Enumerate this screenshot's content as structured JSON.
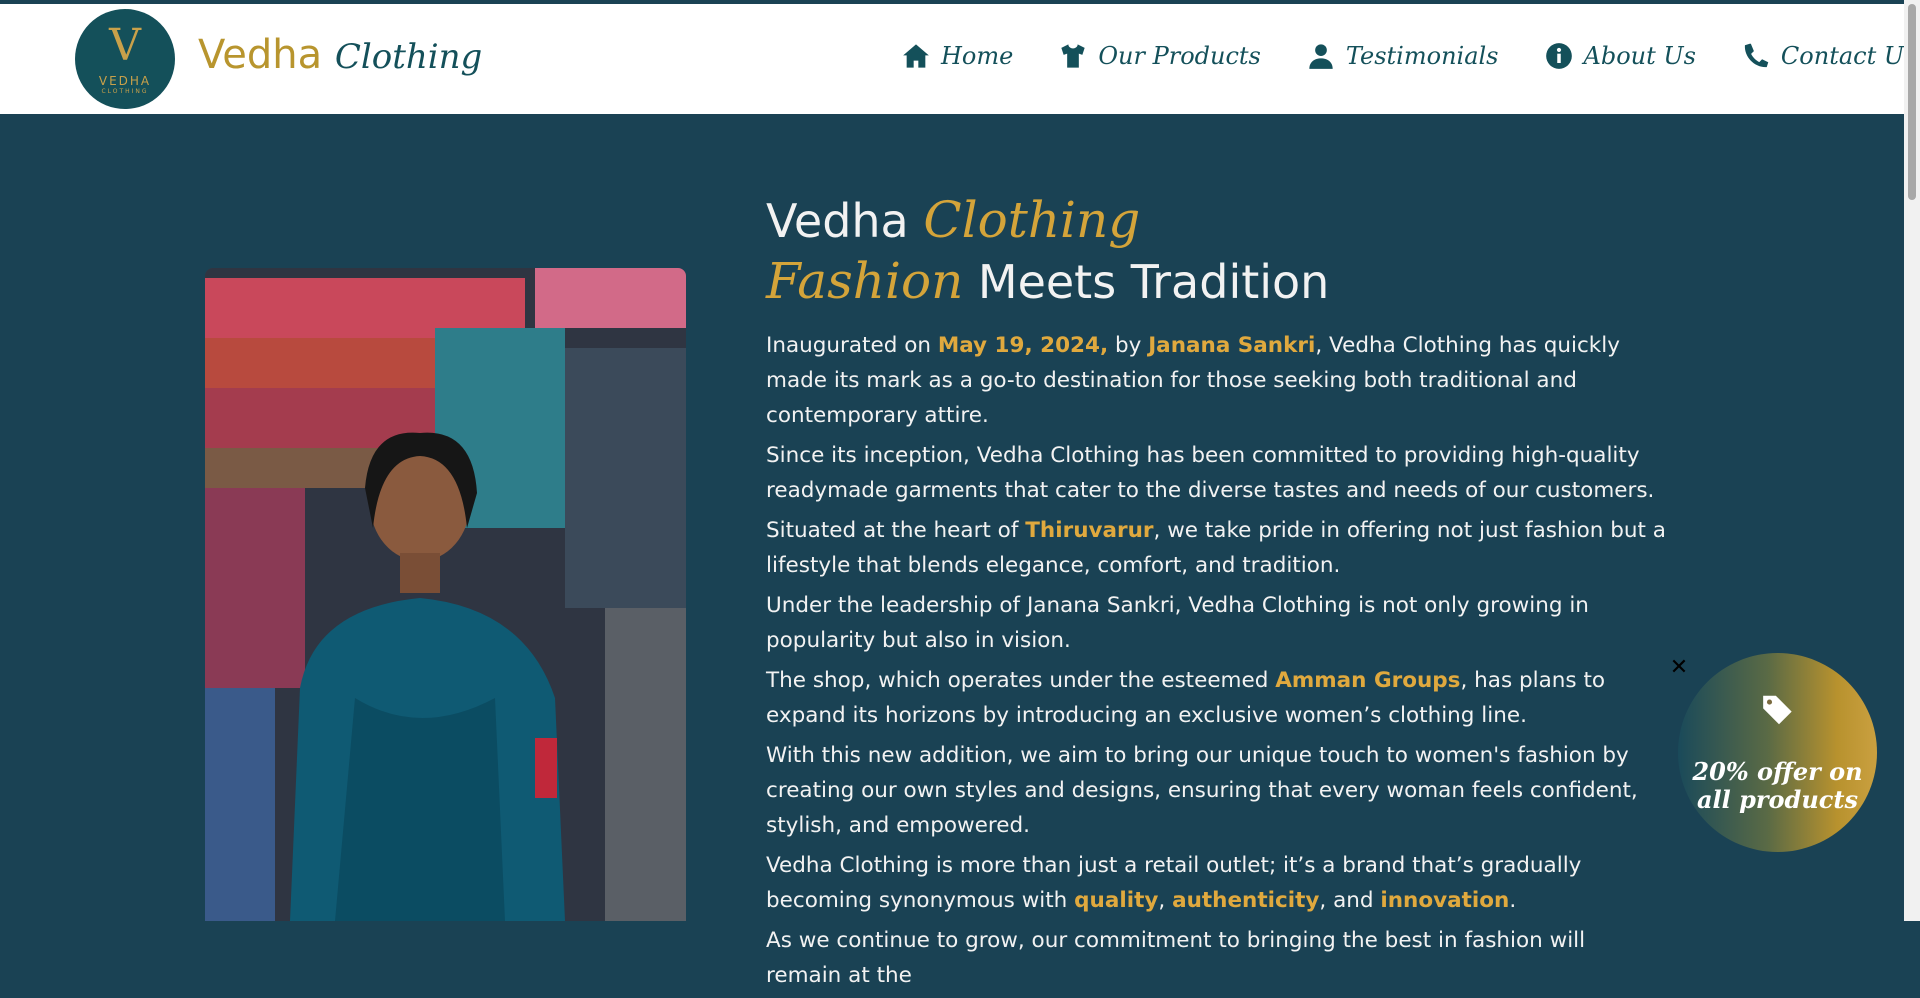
{
  "brand": {
    "logo_main": "V",
    "logo_line1": "VEDHA",
    "logo_line2": "CLOTHING",
    "name": "Vedha",
    "name_script": "Clothing"
  },
  "nav": {
    "items": [
      {
        "label": "Home",
        "icon": "home-icon"
      },
      {
        "label": "Our Products",
        "icon": "shirt-icon"
      },
      {
        "label": "Testimonials",
        "icon": "user-icon"
      },
      {
        "label": "About Us",
        "icon": "info-icon"
      },
      {
        "label": "Contact Us",
        "icon": "phone-icon"
      }
    ]
  },
  "hero": {
    "title_line1_plain": "Vedha ",
    "title_line1_script": "Clothing",
    "title_line2_script": "Fashion",
    "title_line2_plain": " Meets Tradition",
    "p1": {
      "a": "Inaugurated on ",
      "date": "May 19, 2024,",
      "b": " by ",
      "name": "Janana Sankri",
      "c": ", Vedha Clothing has quickly made its mark as a go-to destination for those seeking both traditional and contemporary attire."
    },
    "p2": "Since its inception, Vedha Clothing has been committed to providing high-quality readymade garments that cater to the diverse tastes and needs of our customers.",
    "p3": {
      "a": "Situated at the heart of ",
      "place": "Thiruvarur",
      "b": ", we take pride in offering not just fashion but a lifestyle that blends elegance, comfort, and tradition."
    },
    "p4": "Under the leadership of Janana Sankri, Vedha Clothing is not only growing in popularity but also in vision.",
    "p5": {
      "a": "The shop, which operates under the esteemed ",
      "group": "Amman Groups",
      "b": ", has plans to expand its horizons by introducing an exclusive women’s clothing line."
    },
    "p6": "With this new addition, we aim to bring our unique touch to women's fashion by creating our own styles and designs, ensuring that every woman feels confident, stylish, and empowered.",
    "p7": {
      "a": "Vedha Clothing is more than just a retail outlet; it’s a brand that’s gradually becoming synonymous with ",
      "w1": "quality",
      "s1": ", ",
      "w2": "authenticity",
      "s2": ", and ",
      "w3": "innovation",
      "end": "."
    },
    "p8": "As we continue to grow, our commitment to bringing the best in fashion will remain at the"
  },
  "offer": {
    "text_line1": "20% offer on",
    "text_line2": "all products",
    "close": "✕",
    "icon": "tags-icon"
  },
  "colors": {
    "primary": "#1a4254",
    "accent": "#d4a43a",
    "nav_text": "#14505a"
  }
}
